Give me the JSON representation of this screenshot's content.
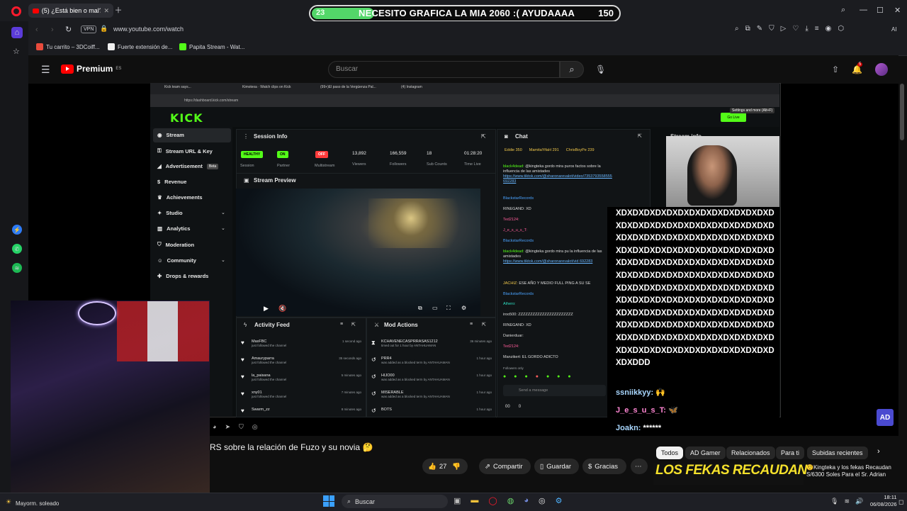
{
  "browser": {
    "tab_label": "(5) ¿Está bien o mal?",
    "url": "www.youtube.com/watch",
    "vpn_label": "VPN",
    "bookmarks": [
      {
        "label": "Tu carrito – 3DCoiff...",
        "color": "#e94b3c"
      },
      {
        "label": "Fuerte extensión de...",
        "color": "#f0f0f0"
      },
      {
        "label": "Papita Stream - Wat...",
        "color": "#53fc18"
      }
    ],
    "ai_label": "AI"
  },
  "alert": {
    "level": "23",
    "message": "NECESITO GRAFICA LA MIA 2060 :( AYUDAAAA",
    "goal": "150"
  },
  "youtube": {
    "logo_text": "Premium",
    "logo_region": "ES",
    "search_placeholder": "Buscar",
    "notifications": "5",
    "video_title": "RS sobre la relación de Fuzo y su novia 🤔",
    "likes": "27",
    "share_label": "Compartir",
    "save_label": "Guardar",
    "thanks_label": "Gracias",
    "chips": [
      "Todos",
      "AD Gamer",
      "Relacionados",
      "Para ti",
      "Subidas recientes"
    ],
    "sidebar_video": {
      "thumb_text": "LOS FEKAS RECAUDAN",
      "title": "🤨Kingteka y los fekas Recaudan S/6300 Soles Para el Sr. Adrian"
    }
  },
  "kick": {
    "tabs": [
      "Kick team says...",
      "Kimotexa · Watch clips on Kick",
      "(99+)El paso de la Vergüenza Pal...",
      "(4) Instagram"
    ],
    "url": "https://dashboard.kick.com/stream",
    "logo": "KICK",
    "go_live": "Go Live",
    "tooltip": "Settings and more (Alt+F)",
    "sidebar": [
      {
        "label": "Stream",
        "chevron": false
      },
      {
        "label": "Stream URL & Key",
        "chevron": false
      },
      {
        "label": "Advertisement",
        "chevron": false,
        "badge": "Beta"
      },
      {
        "label": "Revenue",
        "chevron": false
      },
      {
        "label": "Achievements",
        "chevron": false
      },
      {
        "label": "Studio",
        "chevron": true
      },
      {
        "label": "Analytics",
        "chevron": true
      },
      {
        "label": "Moderation",
        "chevron": false
      },
      {
        "label": "Community",
        "chevron": true
      },
      {
        "label": "Drops & rewards",
        "chevron": false
      }
    ],
    "session_info": {
      "title": "Session Info",
      "badges": [
        {
          "value": "HEALTHY",
          "label": "Session",
          "color": "#53fc18"
        },
        {
          "value": "ON",
          "label": "Partner",
          "color": "#53fc18"
        },
        {
          "value": "OFF",
          "label": "Multistream",
          "color": "#ff3b3b"
        }
      ],
      "stats": [
        {
          "value": "13,892",
          "label": "Viewers"
        },
        {
          "value": "166,559",
          "label": "Followers"
        },
        {
          "value": "18",
          "label": "Sub Counts"
        },
        {
          "value": "01:28:20",
          "label": "Time Live"
        }
      ]
    },
    "preview_title": "Stream Preview",
    "activity_feed": {
      "title": "Activity Feed",
      "rows": [
        {
          "name": "MaxFBC",
          "sub": "just followed the channel",
          "time": "1 second ago"
        },
        {
          "name": "Amauryparra",
          "sub": "just followed the channel",
          "time": "35 seconds ago"
        },
        {
          "name": "la_paisana",
          "sub": "just followed the channel",
          "time": "5 minutes ago"
        },
        {
          "name": "xny01",
          "sub": "just followed the channel",
          "time": "7 minutes ago"
        },
        {
          "name": "Swarm_zz",
          "sub": "",
          "time": "8 minutes ago"
        }
      ]
    },
    "mod_actions": {
      "title": "Mod Actions",
      "rows": [
        {
          "name": "KCHAVENECASPRRASAS1212",
          "sub": "timed out for 1 hour by ANTAHUAMAN",
          "time": "36 minutes ago"
        },
        {
          "name": "PRR4",
          "sub": "was added as a blocked term by ANTAHUAMAN",
          "time": "1 hour ago"
        },
        {
          "name": "HIJO00",
          "sub": "was added as a blocked term by ANTAHUAMAN",
          "time": "1 hour ago"
        },
        {
          "name": "MISERABLE",
          "sub": "was added as a blocked term by ANTAHUAMAN",
          "time": "1 hour ago"
        },
        {
          "name": "BOTS",
          "sub": "",
          "time": "1 hour ago"
        }
      ]
    },
    "chat": {
      "title": "Chat",
      "top": [
        "Eddie 350",
        "MamitaYifaH 291",
        "ChrisBoyPe 239"
      ],
      "lines": [
        {
          "user": "black4dead:",
          "text": "@kingteka gordo mira puros factos sobre la influencia de las amistades",
          "link": "https://www.tiktok.com/@sharonarevalot/video/7353793558555 692283"
        },
        {
          "user": "BlackstarRecords",
          "text": ""
        },
        {
          "user": "RINEGAND:",
          "text": "XD"
        },
        {
          "user": "Ted2124:",
          "text": ""
        },
        {
          "user": "J_e_s_u_s_T:",
          "text": ""
        },
        {
          "user": "BlackstarRecords",
          "text": ""
        },
        {
          "user": "black4dead:",
          "text": "@kingteka gordo mira pu la influencia de las amistades",
          "link": "https://www.tiktok.com/@sharonarevalot/vid 692283"
        },
        {
          "user": "JACHIZ:",
          "text": "ESE AÑO Y MEDIO FULL PING A SU SE"
        },
        {
          "user": "BlackstarRecords",
          "text": ""
        },
        {
          "user": "Aihero:",
          "text": ""
        },
        {
          "user": "iroo500:",
          "text": "ZZZZZZZZZZZZZZZZZZZZZZZ"
        },
        {
          "user": "RINEGAND:",
          "text": "XD"
        },
        {
          "user": "Danierduar:",
          "text": ""
        },
        {
          "user": "Ted2124:",
          "text": ""
        },
        {
          "user": "Manzikert:",
          "text": "EL GORDO ADICTO"
        }
      ],
      "followers_only": "Followers only",
      "send_placeholder": "Send a message",
      "count_a": "00",
      "count_b": "0"
    },
    "stream_info_title": "Stream info"
  },
  "overlay_chat": {
    "xd_text": "XDXDXDXDXDXDXDXDXDXDXDXDXDXDXDXDXDXDXDXDXDXDXDXDXDXDXDXDXDXDXDXDXDXDXDXDXDXDXDXDXDXDXDXDXDXDXDXDXDXDXDXDXDXDXDXDXDXDXDXDXDXDXDXDXDXDXDXDXDXDXDXDXDXDXDXDXDXDXDXDXDXDXDXDXDXDXDXDXDXDXDXDXDXDXDXDXDXDXDXDXDXDXDXDXDXDXDXDXDXDXDXDXDXDXDXDXDXDXDXDXDXDXDXDXDXDXDXDXDXDXDXDXDXDXDXDXDXDXDXDXDXDXDXDXDXDXDXDXDXDXDXDXDXDXDXDXDXDXDXDXDXDXDXDXDXDXDXDXDXDDD",
    "lines": [
      {
        "user": "ssniikkyy:",
        "text": "🙌"
      },
      {
        "user": "J_e_s_u_s_T:",
        "text": "🦋"
      },
      {
        "user": "Joakn:",
        "text": "******"
      }
    ],
    "watermark": "AD"
  },
  "taskbar": {
    "weather": "Mayorm. soleado",
    "search": "Buscar",
    "time": "18:11",
    "date": "06/08/2026"
  }
}
